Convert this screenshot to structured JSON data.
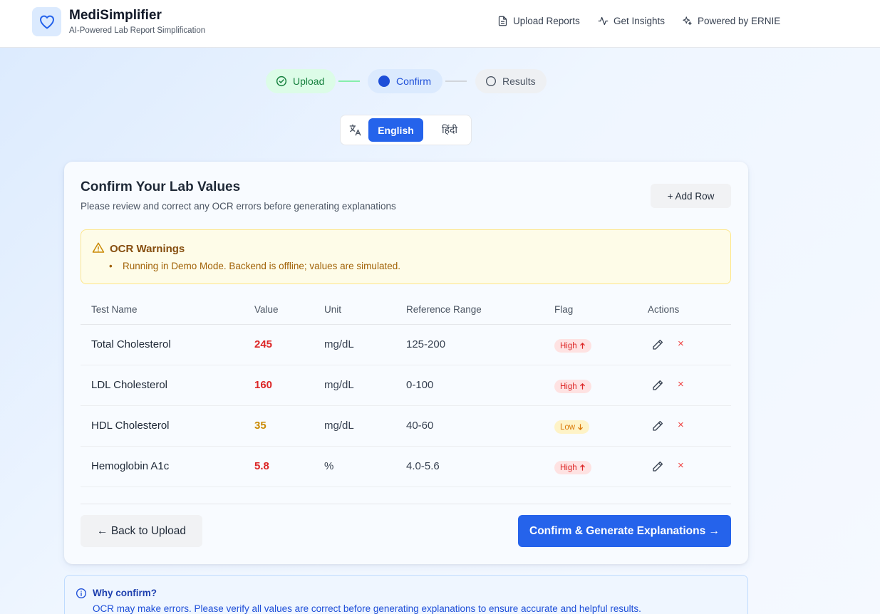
{
  "header": {
    "brand_title": "MediSimplifier",
    "brand_subtitle": "AI-Powered Lab Report Simplification",
    "nav": [
      {
        "label": "Upload Reports",
        "icon": "document-icon"
      },
      {
        "label": "Get Insights",
        "icon": "activity-icon"
      },
      {
        "label": "Powered by ERNIE",
        "icon": "sparkles-icon"
      }
    ]
  },
  "stepper": {
    "steps": [
      {
        "label": "Upload",
        "state": "done"
      },
      {
        "label": "Confirm",
        "state": "active"
      },
      {
        "label": "Results",
        "state": "pending"
      }
    ]
  },
  "language": {
    "options": [
      "English",
      "हिंदी"
    ],
    "selected": "English"
  },
  "card": {
    "title": "Confirm Your Lab Values",
    "subtitle": "Please review and correct any OCR errors before generating explanations",
    "add_row_label": "+ Add Row",
    "warning": {
      "title": "OCR Warnings",
      "items": [
        "Running in Demo Mode. Backend is offline; values are simulated."
      ]
    },
    "table": {
      "headers": [
        "Test Name",
        "Value",
        "Unit",
        "Reference Range",
        "Flag",
        "Actions"
      ],
      "rows": [
        {
          "name": "Total Cholesterol",
          "value": "245",
          "unit": "mg/dL",
          "range": "125-200",
          "flag": "High",
          "flag_type": "high"
        },
        {
          "name": "LDL Cholesterol",
          "value": "160",
          "unit": "mg/dL",
          "range": "0-100",
          "flag": "High",
          "flag_type": "high"
        },
        {
          "name": "HDL Cholesterol",
          "value": "35",
          "unit": "mg/dL",
          "range": "40-60",
          "flag": "Low",
          "flag_type": "low"
        },
        {
          "name": "Hemoglobin A1c",
          "value": "5.8",
          "unit": "%",
          "range": "4.0-5.6",
          "flag": "High",
          "flag_type": "high"
        }
      ],
      "delete_symbol": "×"
    },
    "back_label": "← Back to Upload",
    "confirm_label": "Confirm & Generate Explanations →"
  },
  "info": {
    "title": "Why confirm?",
    "text": "OCR may make errors. Please verify all values are correct before generating explanations to ensure accurate and helpful results."
  },
  "colors": {
    "primary": "#2563eb",
    "high": "#dc2626",
    "low": "#ca8a04",
    "success": "#15803d"
  }
}
